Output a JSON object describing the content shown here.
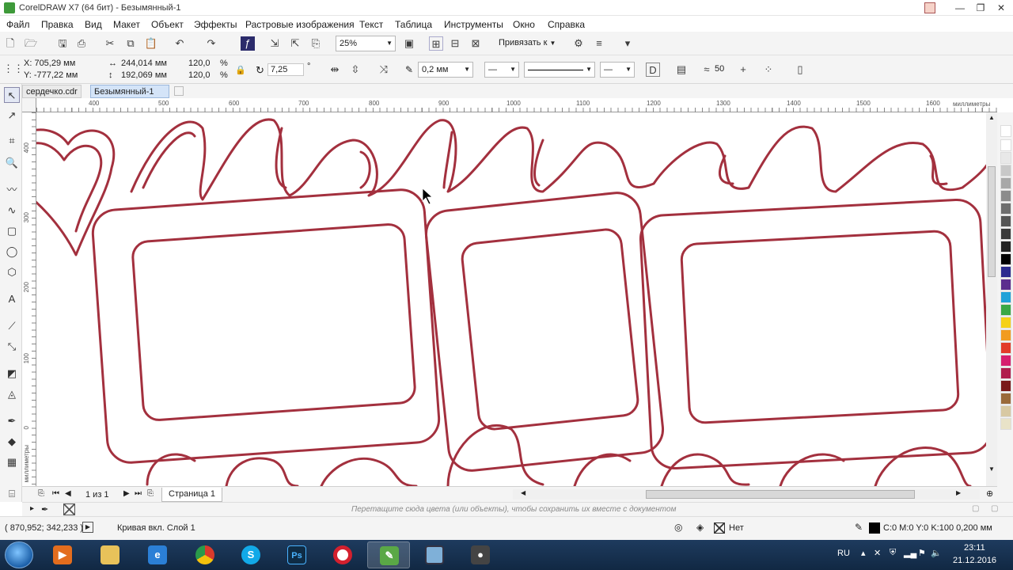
{
  "window": {
    "title": "CorelDRAW X7 (64 бит) - Безымянный-1",
    "minimize": "—",
    "maximize": "❐",
    "close": "✕"
  },
  "menu": [
    "Файл",
    "Правка",
    "Вид",
    "Макет",
    "Объект",
    "Эффекты",
    "Растровые изображения",
    "Текст",
    "Таблица",
    "Инструменты",
    "Окно",
    "Справка"
  ],
  "toolbar": {
    "zoom": "25%",
    "snap_label": "Привязать к"
  },
  "props": {
    "x": "X: 705,29 мм",
    "y": "Y: -777,22 мм",
    "width": "244,014 мм",
    "height": "192,069 мм",
    "scale_x": "120,0",
    "scale_y": "120,0",
    "percent": "%",
    "rotation": "7,25",
    "degree": "°",
    "outline_width": "0,2 мм",
    "smooth": "50"
  },
  "doc_tabs": [
    "сердечко.cdr",
    "Безымянный-1"
  ],
  "ruler": {
    "h_ticks": [
      "400",
      "500",
      "600",
      "700",
      "800",
      "900",
      "1000",
      "1100",
      "1200",
      "1300",
      "1400",
      "1500",
      "1600"
    ],
    "h_unit": "миллиметры",
    "v_ticks": [
      "400",
      "300",
      "200",
      "100",
      "0"
    ],
    "v_unit": "миллиметры"
  },
  "page_nav": {
    "counter": "1 из 1",
    "page_tab": "Страница 1"
  },
  "doc_palette_hint": "Перетащите сюда цвета (или объекты), чтобы сохранить их вместе с документом",
  "status": {
    "coords": "( 870,952; 342,233 )",
    "object_info": "Кривая вкл. Слой 1",
    "fill": "Нет",
    "outline": "C:0 M:0 Y:0 K:100  0,200 мм"
  },
  "taskbar": {
    "lang": "RU",
    "time": "23:11",
    "date": "21.12.2016"
  },
  "colors": {
    "outline": "#a3303e",
    "palette": [
      "#ffffff",
      "#e8e8e8",
      "#c8c8c8",
      "#8c8c8c",
      "#3a3a3a",
      "#000000",
      "#2b2b8f",
      "#5b2d8e",
      "#0a6fb5",
      "#1fa2d8",
      "#3aa845",
      "#c6d22b",
      "#f5d117",
      "#f29b1f",
      "#e23b2a",
      "#d61f6f",
      "#b01e4e",
      "#7a1a1a",
      "#9a6a3a",
      "#d8c9a3"
    ]
  },
  "icons": [
    "corel-logo-icon",
    "new-icon",
    "open-icon",
    "save-icon",
    "print-icon",
    "cut-icon",
    "copy-icon",
    "paste-icon",
    "undo-icon",
    "redo-icon",
    "pick-tool-icon",
    "zoom-tool-icon",
    "text-tool-icon"
  ]
}
